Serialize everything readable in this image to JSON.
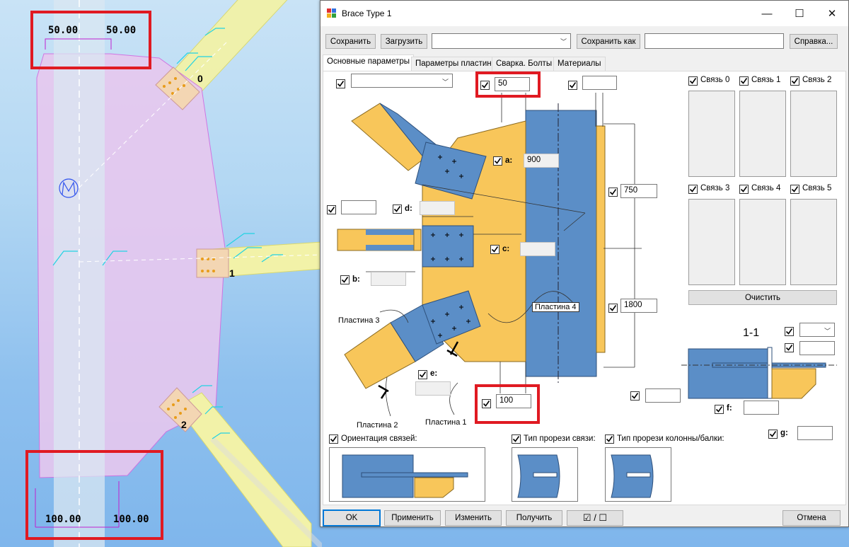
{
  "viewport": {
    "dims_top": [
      "50.00",
      "50.00"
    ],
    "dims_bottom": [
      "100.00",
      "100.00"
    ],
    "node_labels": [
      "0",
      "1",
      "2"
    ]
  },
  "dialog": {
    "title": "Brace Type 1",
    "controls": {
      "minimize": "—",
      "maximize": "☐",
      "close": "✕"
    },
    "toolbar": {
      "save": "Сохранить",
      "load": "Загрузить",
      "preset_value": "",
      "save_as": "Сохранить как",
      "save_as_name": "",
      "help": "Справка..."
    },
    "tabs": [
      "Основные параметры",
      "Параметры пластин",
      "Сварка. Болты",
      "Материалы"
    ],
    "params": {
      "top_combo": "",
      "top_dim_left": "50",
      "top_dim_right": "",
      "a_label": "a:",
      "a_value": "900",
      "h1_value": "750",
      "h2_value": "1800",
      "left_field": "",
      "d_label": "d:",
      "d_value": "",
      "c_label": "c:",
      "c_value": "",
      "b_label": "b:",
      "b_value": "",
      "e_label": "e:",
      "e_value": "",
      "bottom_dim": "100",
      "plate_labels": [
        "Пластина 3",
        "Пластина 4",
        "Пластина 2",
        "Пластина 1"
      ],
      "section_label": "1-1",
      "sec_combo": "",
      "sec_field1": "",
      "sec_field2": "",
      "f_label": "f:",
      "f_value": "",
      "g_label": "g:",
      "g_value": ""
    },
    "connections": [
      "Связь 0",
      "Связь 1",
      "Связь 2",
      "Связь 3",
      "Связь 4",
      "Связь 5"
    ],
    "clear": "Очистить",
    "options": [
      "Ориентация связей:",
      "Тип прорези связи:",
      "Тип прорези колонны/балки:"
    ],
    "bottom": {
      "ok": "OK",
      "apply": "Применить",
      "modify": "Изменить",
      "get": "Получить",
      "toggle": "☑ / ☐",
      "cancel": "Отмена"
    }
  },
  "colors": {
    "steel_blue": "#5b8ec7",
    "plate_orange": "#f8c65a",
    "gusset_pink": "#e8c6ee",
    "brace_yellow": "#f2f2a0",
    "highlight_red": "#e01a22"
  }
}
